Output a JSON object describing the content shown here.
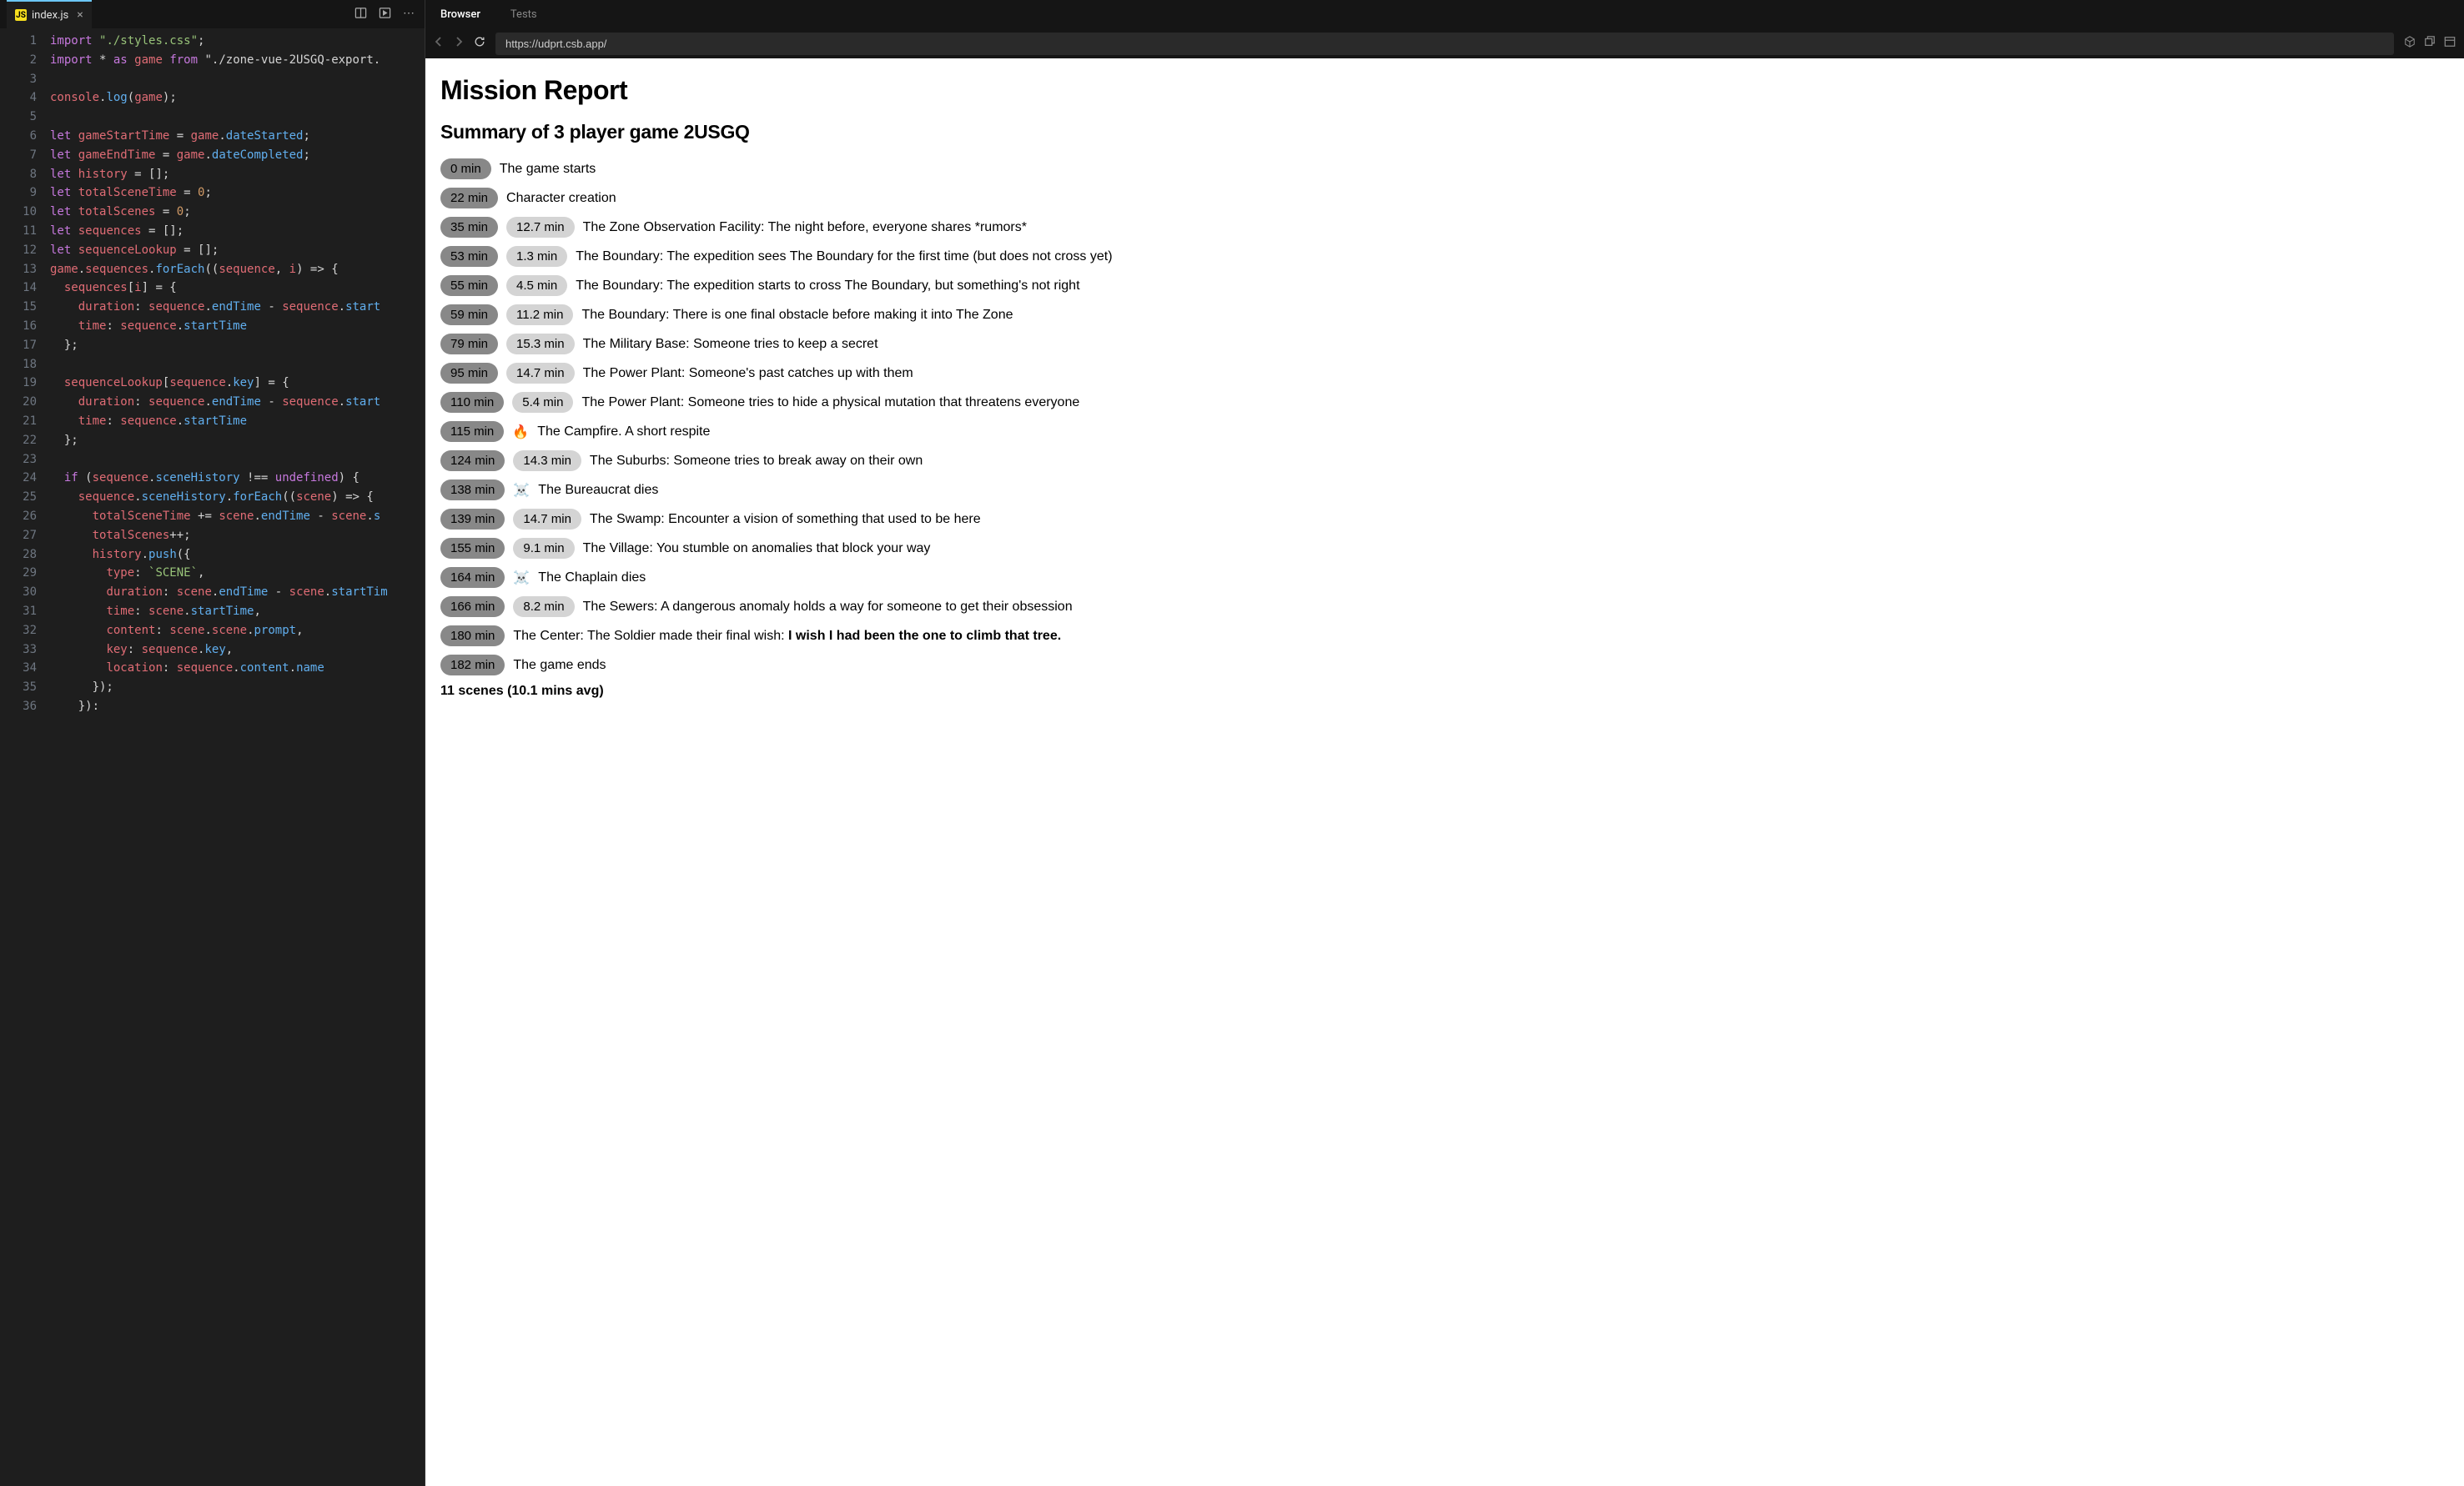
{
  "tabs": {
    "file_name": "index.js",
    "file_icon": "JS"
  },
  "toolbar_icons": {
    "split": "split-icon",
    "terminal": "terminal-icon",
    "more": "more-icon"
  },
  "code": {
    "lines": [
      "import \"./styles.css\";",
      "import * as game from \"./zone-vue-2USGQ-export.",
      "",
      "console.log(game);",
      "",
      "let gameStartTime = game.dateStarted;",
      "let gameEndTime = game.dateCompleted;",
      "let history = [];",
      "let totalSceneTime = 0;",
      "let totalScenes = 0;",
      "let sequences = [];",
      "let sequenceLookup = [];",
      "game.sequences.forEach((sequence, i) => {",
      "  sequences[i] = {",
      "    duration: sequence.endTime - sequence.start",
      "    time: sequence.startTime",
      "  };",
      "",
      "  sequenceLookup[sequence.key] = {",
      "    duration: sequence.endTime - sequence.start",
      "    time: sequence.startTime",
      "  };",
      "",
      "  if (sequence.sceneHistory !== undefined) {",
      "    sequence.sceneHistory.forEach((scene) => {",
      "      totalSceneTime += scene.endTime - scene.s",
      "      totalScenes++;",
      "      history.push({",
      "        type: `SCENE`,",
      "        duration: scene.endTime - scene.startTim",
      "        time: scene.startTime,",
      "        content: scene.scene.prompt,",
      "        key: sequence.key,",
      "        location: sequence.content.name",
      "      });",
      "    }):"
    ]
  },
  "preview_tabs": {
    "browser": "Browser",
    "tests": "Tests"
  },
  "url": "https://udprt.csb.app/",
  "report": {
    "title": "Mission Report",
    "subtitle": "Summary of 3 player game 2USGQ",
    "events": [
      {
        "time": "0 min",
        "dur": null,
        "icon": null,
        "text": "The game starts"
      },
      {
        "time": "22 min",
        "dur": null,
        "icon": null,
        "text": "Character creation"
      },
      {
        "time": "35 min",
        "dur": "12.7 min",
        "icon": null,
        "text": "The Zone Observation Facility: The night before, everyone shares *rumors*"
      },
      {
        "time": "53 min",
        "dur": "1.3 min",
        "icon": null,
        "text": "The Boundary: The expedition sees The Boundary for the first time (but does not cross yet)"
      },
      {
        "time": "55 min",
        "dur": "4.5 min",
        "icon": null,
        "text": "The Boundary: The expedition starts to cross The Boundary, but something's not right"
      },
      {
        "time": "59 min",
        "dur": "11.2 min",
        "icon": null,
        "text": "The Boundary: There is one final obstacle before making it into The Zone"
      },
      {
        "time": "79 min",
        "dur": "15.3 min",
        "icon": null,
        "text": "The Military Base: Someone tries to keep a secret"
      },
      {
        "time": "95 min",
        "dur": "14.7 min",
        "icon": null,
        "text": "The Power Plant: Someone's past catches up with them"
      },
      {
        "time": "110 min",
        "dur": "5.4 min",
        "icon": null,
        "text": "The Power Plant: Someone tries to hide a physical mutation that threatens everyone"
      },
      {
        "time": "115 min",
        "dur": null,
        "icon": "🔥",
        "text": "The Campfire. A short respite"
      },
      {
        "time": "124 min",
        "dur": "14.3 min",
        "icon": null,
        "text": "The Suburbs: Someone tries to break away on their own"
      },
      {
        "time": "138 min",
        "dur": null,
        "icon": "☠️",
        "text": "The Bureaucrat dies"
      },
      {
        "time": "139 min",
        "dur": "14.7 min",
        "icon": null,
        "text": "The Swamp: Encounter a vision of something that used to be here"
      },
      {
        "time": "155 min",
        "dur": "9.1 min",
        "icon": null,
        "text": "The Village: You stumble on anomalies that block your way"
      },
      {
        "time": "164 min",
        "dur": null,
        "icon": "☠️",
        "text": "The Chaplain dies"
      },
      {
        "time": "166 min",
        "dur": "8.2 min",
        "icon": null,
        "text": "The Sewers: A dangerous anomaly holds a way for someone to get their obsession"
      },
      {
        "time": "180 min",
        "dur": null,
        "icon": null,
        "text_prefix": "The Center: The Soldier made their final wish: ",
        "text_bold": "I wish I had been the one to climb that tree."
      },
      {
        "time": "182 min",
        "dur": null,
        "icon": null,
        "text": "The game ends"
      }
    ],
    "summary": "11 scenes (10.1 mins avg)"
  }
}
